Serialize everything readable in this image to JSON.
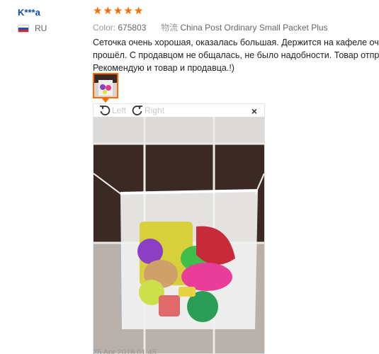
{
  "reviewer": {
    "name": "K***a",
    "country_code": "RU"
  },
  "rating": {
    "stars": 5,
    "color": "#ff6a00"
  },
  "meta": {
    "color_label": "Color:",
    "color_value": "675803",
    "shipping_label": "物流",
    "shipping_value": "China Post Ordinary Small Packet Plus"
  },
  "review": {
    "lines": [
      "Сеточка очень хорошая, оказалась большая. Держится на кафеле очень хо",
      "прошёл. С продавцом не общалась, не было надобности. Товар отправлен",
      "Рекомендую и товар и продавца.!)"
    ]
  },
  "viewer": {
    "rotate_left_label": "Left",
    "rotate_right_label": "Right",
    "close_label": "×"
  },
  "date": "25 Apr 2018 01:45",
  "icons": {
    "flag": "russia-flag-icon",
    "rotate_left": "rotate-left-icon",
    "rotate_right": "rotate-right-icon",
    "close": "close-icon",
    "star": "star-icon"
  }
}
